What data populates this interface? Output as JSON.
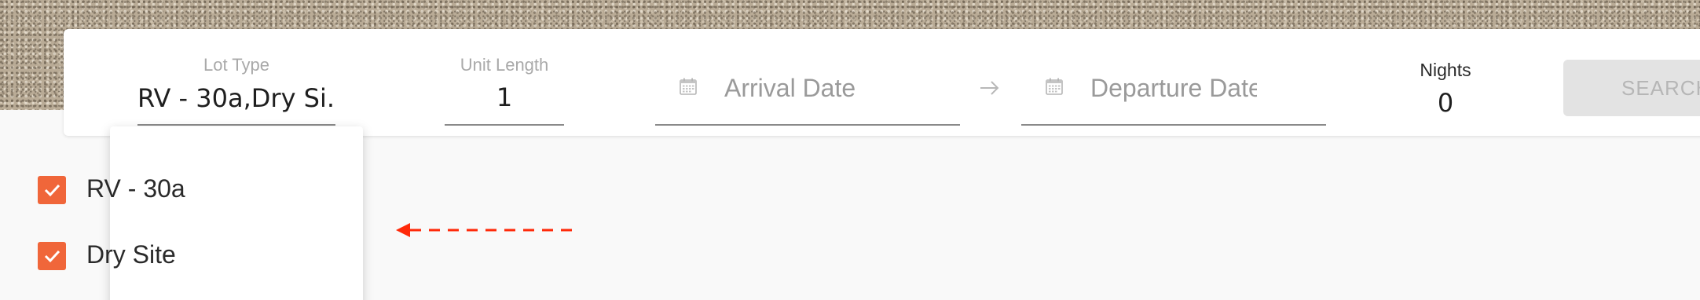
{
  "search_bar": {
    "lot_type": {
      "label": "Lot Type",
      "value": "RV - 30a,Dry Si..."
    },
    "unit_length": {
      "label": "Unit Length",
      "value": "1"
    },
    "arrival_date": {
      "placeholder": "Arrival Date",
      "icon": "calendar-icon"
    },
    "departure_date": {
      "placeholder": "Departure Date",
      "icon": "calendar-icon"
    },
    "date_separator_icon": "arrow-right-icon",
    "nights": {
      "label": "Nights",
      "value": "0"
    },
    "search_button_label": "SEARCH"
  },
  "lot_type_dropdown": {
    "options": [
      {
        "label": "RV - 30a",
        "checked": true
      },
      {
        "label": "Dry Site",
        "checked": true
      }
    ]
  },
  "annotation": {
    "icon": "dashed-arrow-left-icon",
    "color": "#ff2a0a"
  },
  "colors": {
    "accent": "#f0663a",
    "button_disabled_bg": "#e3e3e3",
    "page_background": "#f9f9f9"
  }
}
